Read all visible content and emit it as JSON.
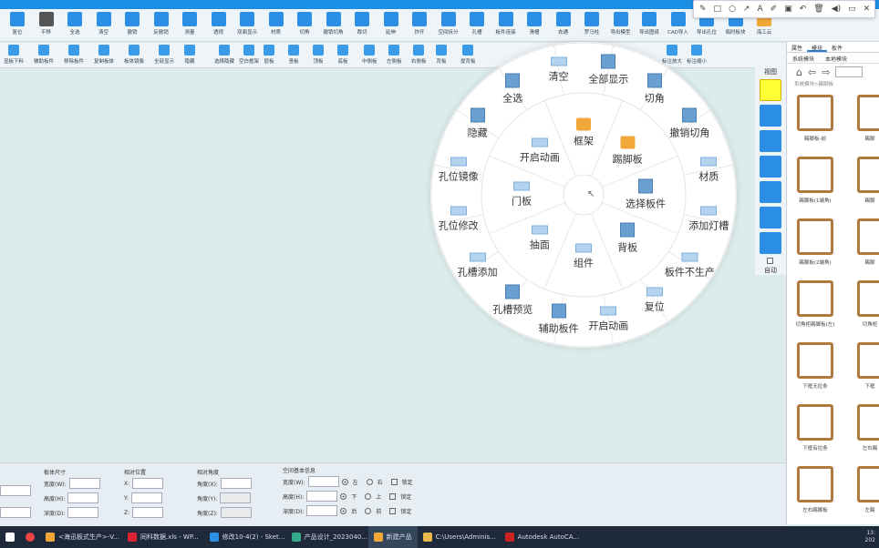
{
  "toolbar1": [
    {
      "label": "复位",
      "color": "#2b8fe6"
    },
    {
      "label": "平移",
      "color": "#555"
    },
    {
      "label": "全选",
      "color": "#2b8fe6"
    },
    {
      "label": "清空",
      "color": "#2b8fe6"
    },
    {
      "label": "撤销",
      "color": "#2b8fe6"
    },
    {
      "label": "反撤销",
      "color": "#2b8fe6"
    },
    {
      "label": "测量",
      "color": "#2b8fe6"
    },
    {
      "label": "透视",
      "color": "#2b8fe6"
    },
    {
      "label": "双面显示",
      "color": "#2b8fe6"
    },
    {
      "label": "材质",
      "color": "#2b8fe6"
    },
    {
      "label": "切角",
      "color": "#2b8fe6"
    },
    {
      "label": "撤销切角",
      "color": "#2b8fe6"
    },
    {
      "label": "裁切",
      "color": "#2b8fe6"
    },
    {
      "label": "延伸",
      "color": "#2b8fe6"
    },
    {
      "label": "炸开",
      "color": "#2b8fe6"
    },
    {
      "label": "空间拆分",
      "color": "#2b8fe6"
    },
    {
      "label": "孔槽",
      "color": "#2b8fe6"
    },
    {
      "label": "板件连接",
      "color": "#2b8fe6"
    },
    {
      "label": "滑槽",
      "color": "#2b8fe6"
    },
    {
      "label": "衣通",
      "color": "#2b8fe6"
    },
    {
      "label": "罗马柱",
      "color": "#2b8fe6"
    },
    {
      "label": "导出模型",
      "color": "#2b8fe6"
    },
    {
      "label": "导出图纸",
      "color": "#2b8fe6"
    },
    {
      "label": "CAD导入",
      "color": "#2b8fe6"
    },
    {
      "label": "导出孔位",
      "color": "#2b8fe6"
    },
    {
      "label": "临时板块",
      "color": "#2b8fe6"
    },
    {
      "label": "海工云",
      "color": "#f2a73b"
    }
  ],
  "toolbar2": [
    "显板下料",
    "辅助板件",
    "移除板件",
    "复制板体",
    "板体镜像",
    "全部显示",
    "隐藏",
    "选择隐藏",
    "空白框架",
    "层板",
    "竖板",
    "顶板",
    "底板",
    "中侧板",
    "左侧板",
    "右侧板",
    "背板",
    "提背板",
    "标注放大",
    "标注缩小"
  ],
  "floatbar": [
    "✎",
    "□",
    "○",
    "↗",
    "A",
    "✐",
    "▣",
    "↶",
    "🗑",
    "◀)",
    "▭",
    "✕"
  ],
  "wheel_outer": [
    {
      "label": "清空",
      "icon": "wico"
    },
    {
      "label": "全部显示",
      "icon": "big"
    },
    {
      "label": "切角",
      "icon": "big"
    },
    {
      "label": "撤销切角",
      "icon": "big"
    },
    {
      "label": "材质",
      "icon": "wico"
    },
    {
      "label": "添加灯槽",
      "icon": "wico"
    },
    {
      "label": "板件不生产",
      "icon": "wico"
    },
    {
      "label": "复位",
      "icon": "wico"
    },
    {
      "label": "开启动画",
      "icon": "wico"
    },
    {
      "label": "辅助板件",
      "icon": "big"
    },
    {
      "label": "孔槽预览",
      "icon": "big"
    },
    {
      "label": "孔槽添加",
      "icon": "wico"
    },
    {
      "label": "孔位修改",
      "icon": "wico"
    },
    {
      "label": "孔位镜像",
      "icon": "wico"
    },
    {
      "label": "隐藏",
      "icon": "big"
    },
    {
      "label": "全选",
      "icon": "big"
    }
  ],
  "wheel_inner": [
    {
      "label": "框架",
      "icon": "folder"
    },
    {
      "label": "踢脚板",
      "icon": "folder"
    },
    {
      "label": "选择板件",
      "icon": "big"
    },
    {
      "label": "背板",
      "icon": "big"
    },
    {
      "label": "组件",
      "icon": "wico"
    },
    {
      "label": "抽面",
      "icon": "wico"
    },
    {
      "label": "门板",
      "icon": "wico"
    },
    {
      "label": "开启动画",
      "icon": "wico"
    }
  ],
  "right_panel": {
    "tabs": [
      "属性",
      "模块",
      "板件"
    ],
    "subtabs": [
      "系统模块",
      "本地模块"
    ],
    "path": "系统模块>踢脚板",
    "items": [
      {
        "label": "踢脚板-前"
      },
      {
        "label": "踢脚"
      },
      {
        "label": "踢脚板(1端角)"
      },
      {
        "label": "踢脚"
      },
      {
        "label": "踢脚板(2端角)"
      },
      {
        "label": "踢脚"
      },
      {
        "label": "切角柜踢脚板(左)"
      },
      {
        "label": "切角柜"
      },
      {
        "label": "下框无拉条"
      },
      {
        "label": "下框"
      },
      {
        "label": "下框有拉条"
      },
      {
        "label": "左右踢"
      },
      {
        "label": "左右踢脚板"
      },
      {
        "label": "左踢"
      }
    ]
  },
  "views": {
    "title": "视图",
    "auto": "自动",
    "count": 7
  },
  "bottom": {
    "size_title": "板体尺寸",
    "width": "宽度(W):",
    "height": "高度(H):",
    "depth": "深度(D):",
    "pos_title": "相对位置",
    "x": "X:",
    "y": "Y:",
    "z": "Z:",
    "angle_title": "相对角度",
    "ax": "角度(X):",
    "ay": "角度(Y):",
    "az": "角度(Z):",
    "space_title": "空间基本信息",
    "sw": "宽度(W):",
    "sh": "高度(H):",
    "sd": "深度(D):",
    "left": "左",
    "right": "右",
    "down": "下",
    "up": "上",
    "back": "后",
    "front": "前",
    "lock": "锁定"
  },
  "taskbar": [
    {
      "label": "<海迅板式生产>-V...",
      "color": "#f2a73b"
    },
    {
      "label": "同科数据.xls - WP...",
      "color": "#d23"
    },
    {
      "label": "修改10-4(2) - Sket...",
      "color": "#2b8fe6"
    },
    {
      "label": "产品设计_2023040...",
      "color": "#3a8"
    },
    {
      "label": "新建产品",
      "color": "#f2a73b"
    },
    {
      "label": "C:\\Users\\Adminis...",
      "color": "#e8b84a"
    },
    {
      "label": "Autodesk AutoCA...",
      "color": "#c22"
    }
  ],
  "clock": {
    "time": "13:",
    "date": "202"
  }
}
